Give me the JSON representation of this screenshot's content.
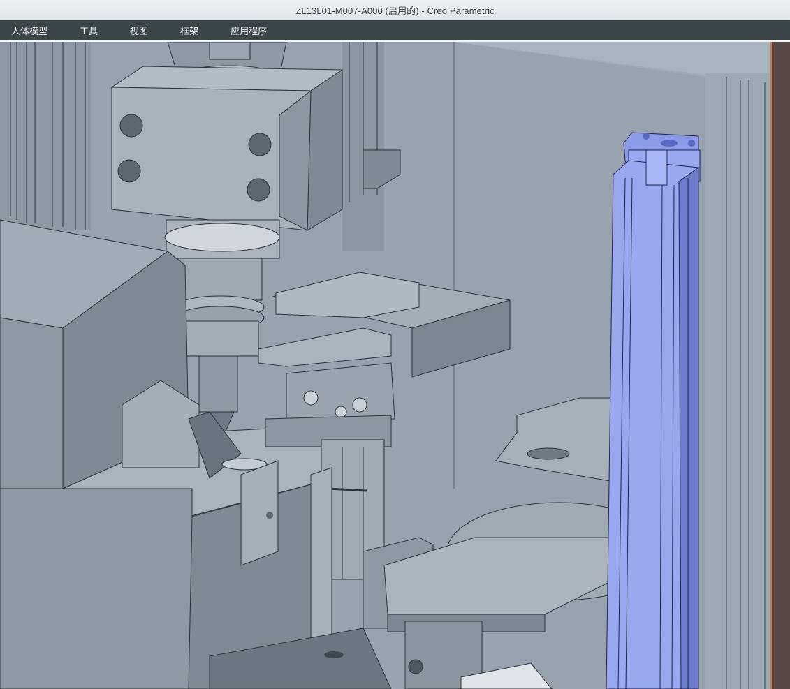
{
  "window": {
    "title": "ZL13L01-M007-A000 (启用的) - Creo Parametric"
  },
  "menubar": {
    "items": [
      {
        "label": "人体模型"
      },
      {
        "label": "工具"
      },
      {
        "label": "视图"
      },
      {
        "label": "框架"
      },
      {
        "label": "应用程序"
      }
    ]
  },
  "viewport": {
    "highlight_color": "#9aa8f0",
    "base_color": "#98a3af"
  }
}
